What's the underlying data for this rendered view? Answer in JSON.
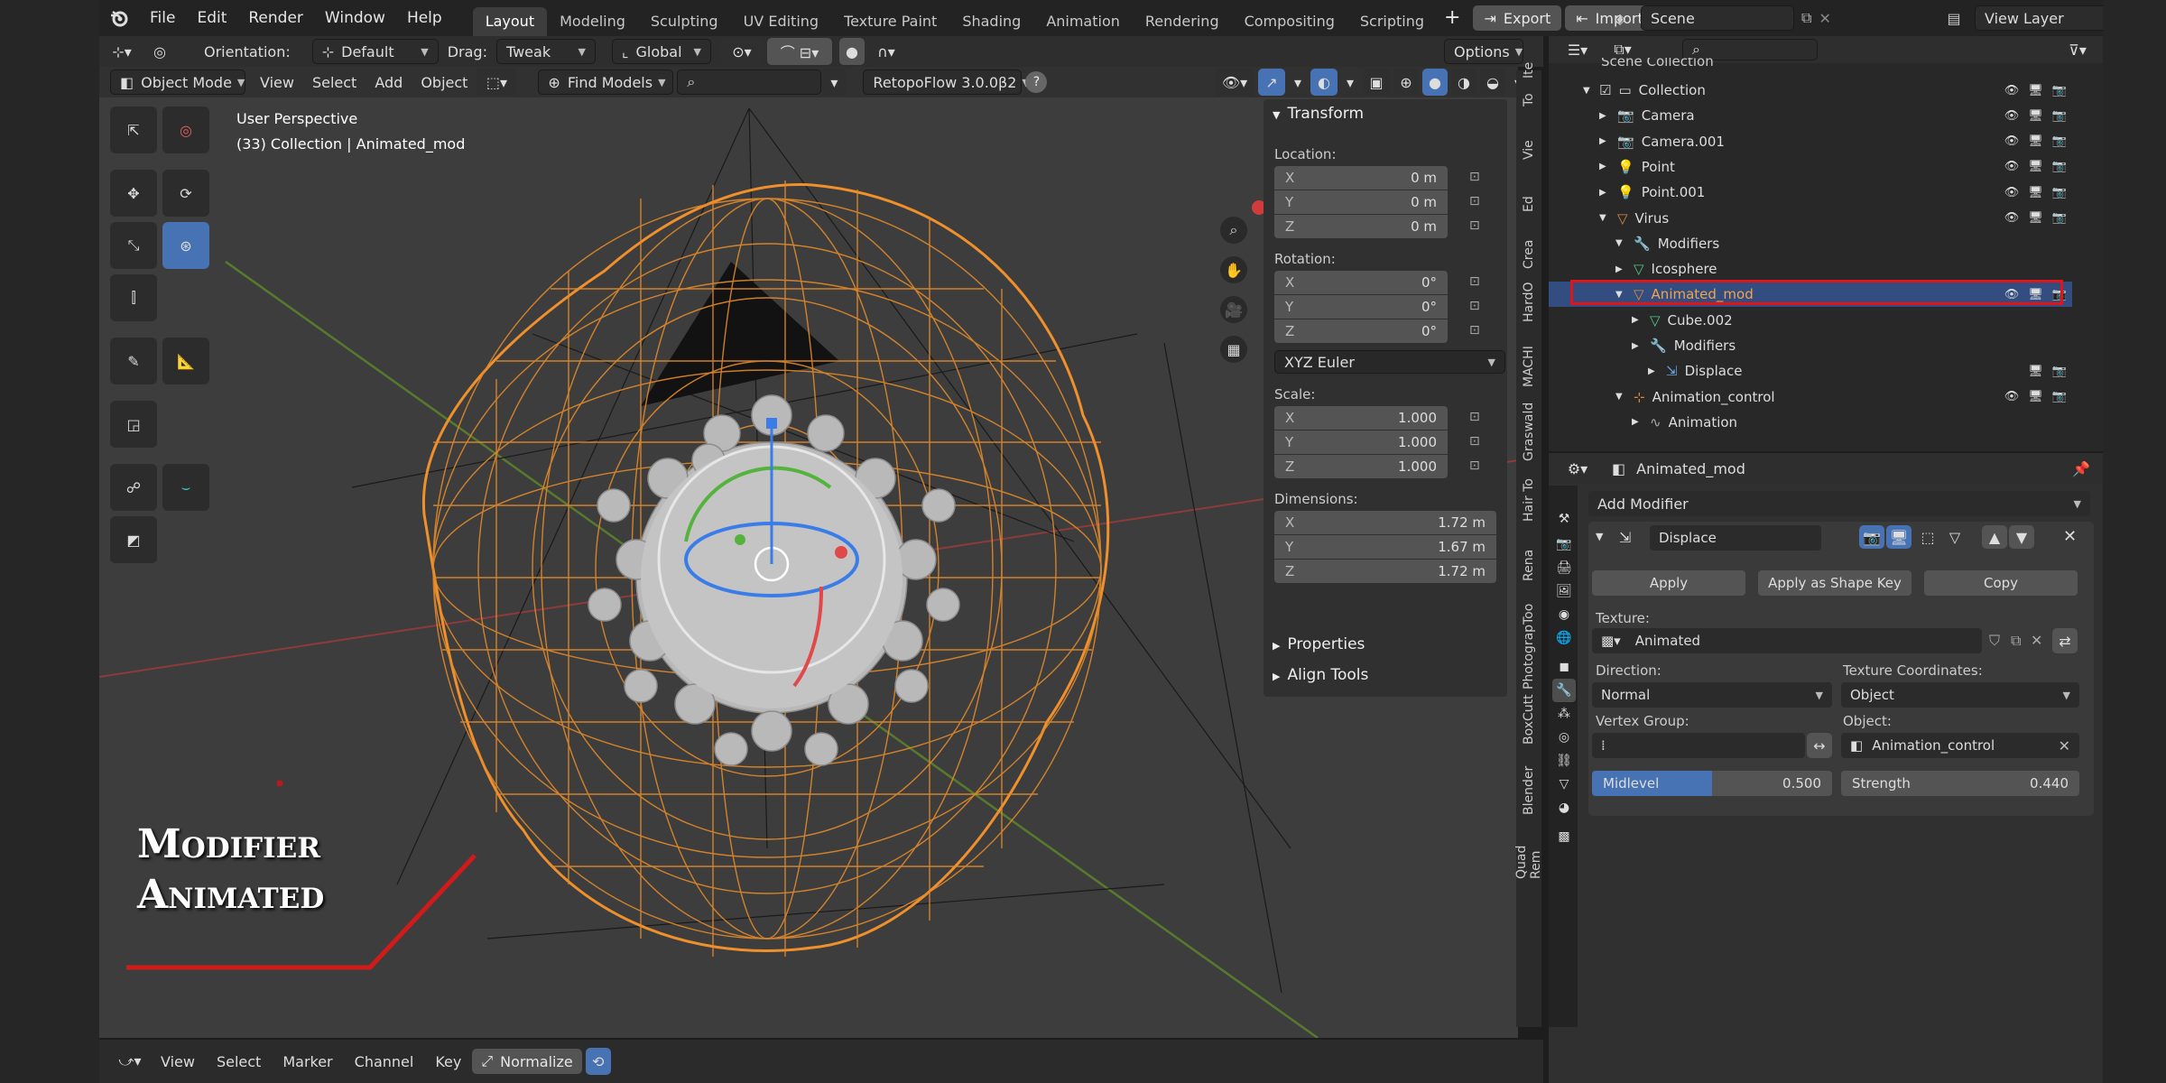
{
  "topbar": {
    "menu": [
      "File",
      "Edit",
      "Render",
      "Window",
      "Help"
    ],
    "workspaces": [
      "Layout",
      "Modeling",
      "Sculpting",
      "UV Editing",
      "Texture Paint",
      "Shading",
      "Animation",
      "Rendering",
      "Compositing",
      "Scripting"
    ],
    "active_workspace": "Layout",
    "add_tab": "+",
    "export_label": "Export",
    "import_label": "Import",
    "scene_value": "Scene",
    "view_layer_value": "View Layer"
  },
  "viewport": {
    "header1": {
      "orientation_label": "Orientation:",
      "orientation_value": "Default",
      "drag_label": "Drag:",
      "drag_value": "Tweak",
      "transform_space": "Global",
      "options_label": "Options"
    },
    "header2": {
      "mode": "Object Mode",
      "menus": [
        "View",
        "Select",
        "Add",
        "Object"
      ],
      "find_models": "Find Models",
      "retopoflow": "RetopoFlow 3.0.0β2"
    },
    "overlay_text": {
      "perspective": "User Perspective",
      "collection_info": "(33) Collection | Animated_mod"
    },
    "gizmo_axes": {
      "x": "X",
      "y": "Y",
      "z": "Z"
    },
    "annotation": {
      "line1": "Modifier",
      "line2": "Animated"
    }
  },
  "npanel": {
    "transform_title": "Transform",
    "location_label": "Location:",
    "location": [
      {
        "axis": "X",
        "value": "0 m"
      },
      {
        "axis": "Y",
        "value": "0 m"
      },
      {
        "axis": "Z",
        "value": "0 m"
      }
    ],
    "rotation_label": "Rotation:",
    "rotation": [
      {
        "axis": "X",
        "value": "0°"
      },
      {
        "axis": "Y",
        "value": "0°"
      },
      {
        "axis": "Z",
        "value": "0°"
      }
    ],
    "rotation_mode": "XYZ Euler",
    "scale_label": "Scale:",
    "scale": [
      {
        "axis": "X",
        "value": "1.000"
      },
      {
        "axis": "Y",
        "value": "1.000"
      },
      {
        "axis": "Z",
        "value": "1.000"
      }
    ],
    "dimensions_label": "Dimensions:",
    "dimensions": [
      {
        "axis": "X",
        "value": "1.72 m"
      },
      {
        "axis": "Y",
        "value": "1.67 m"
      },
      {
        "axis": "Z",
        "value": "1.72 m"
      }
    ],
    "properties_title": "Properties",
    "align_tools_title": "Align Tools"
  },
  "side_tabs": [
    "Ite",
    "To",
    "Vie",
    "Ed",
    "Crea",
    "HardO",
    "MACHI",
    "Graswald",
    "Hair To",
    "Rena",
    "Too",
    "Photograp",
    "BoxCutt",
    "Blender",
    "Quad Rem"
  ],
  "timeline": {
    "menus": [
      "View",
      "Select",
      "Marker",
      "Channel",
      "Key"
    ],
    "normalize": "Normalize"
  },
  "outliner": {
    "scene_collection": "Scene Collection",
    "rows": [
      {
        "label": "Collection",
        "indent": 1,
        "icon": "collection-icon"
      },
      {
        "label": "Camera",
        "indent": 2,
        "icon": "camera-icon"
      },
      {
        "label": "Camera.001",
        "indent": 2,
        "icon": "camera-icon"
      },
      {
        "label": "Point",
        "indent": 2,
        "icon": "light-icon"
      },
      {
        "label": "Point.001",
        "indent": 2,
        "icon": "light-icon"
      },
      {
        "label": "Virus",
        "indent": 2,
        "icon": "mesh-icon"
      },
      {
        "label": "Modifiers",
        "indent": 3,
        "icon": "wrench-icon"
      },
      {
        "label": "Icosphere",
        "indent": 3,
        "icon": "mesh-data-icon"
      },
      {
        "label": "Animated_mod",
        "indent": 3,
        "icon": "mesh-icon",
        "selected": true
      },
      {
        "label": "Cube.002",
        "indent": 4,
        "icon": "mesh-data-icon"
      },
      {
        "label": "Modifiers",
        "indent": 4,
        "icon": "wrench-icon"
      },
      {
        "label": "Displace",
        "indent": 5,
        "icon": "displace-icon"
      },
      {
        "label": "Animation_control",
        "indent": 3,
        "icon": "empty-icon"
      },
      {
        "label": "Animation",
        "indent": 4,
        "icon": "action-icon"
      }
    ]
  },
  "properties": {
    "object_name": "Animated_mod",
    "add_modifier": "Add Modifier",
    "modifier_name": "Displace",
    "apply": "Apply",
    "apply_shape_key": "Apply as Shape Key",
    "copy": "Copy",
    "texture_label": "Texture:",
    "texture_value": "Animated",
    "direction_label": "Direction:",
    "direction_value": "Normal",
    "texture_coords_label": "Texture Coordinates:",
    "texture_coords_value": "Object",
    "vertex_group_label": "Vertex Group:",
    "object_label": "Object:",
    "object_value": "Animation_control",
    "midlevel_label": "Midlevel",
    "midlevel_value": "0.500",
    "midlevel_fraction": 0.5,
    "strength_label": "Strength",
    "strength_value": "0.440"
  },
  "colors": {
    "accent": "#4772b3",
    "selection_outline": "#e0151a",
    "wireframe": "#f0902c",
    "annotation_line": "#d11a1a"
  }
}
